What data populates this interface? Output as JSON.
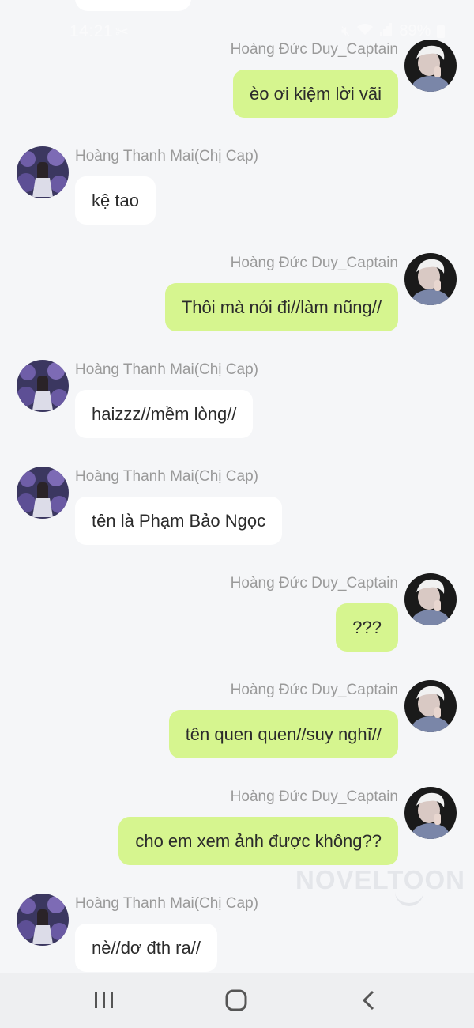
{
  "status_bar": {
    "time": "14:21",
    "app_icon": "capcut-icon",
    "battery": "89%",
    "icons": [
      "mute-icon",
      "wifi-icon",
      "signal-icon",
      "battery-icon"
    ]
  },
  "messages": [
    {
      "side": "sent",
      "sender": "Hoàng Đức Duy_Captain",
      "text": "èo ơi kiệm lời vãi"
    },
    {
      "side": "received",
      "sender": "Hoàng Thanh Mai(Chị Cap)",
      "text": "kệ tao"
    },
    {
      "side": "sent",
      "sender": "Hoàng Đức Duy_Captain",
      "text": "Thôi mà nói đi//làm nũng//"
    },
    {
      "side": "received",
      "sender": "Hoàng Thanh Mai(Chị Cap)",
      "text": "haizzz//mềm lòng//"
    },
    {
      "side": "received",
      "sender": "Hoàng Thanh Mai(Chị Cap)",
      "text": "tên là Phạm Bảo Ngọc"
    },
    {
      "side": "sent",
      "sender": "Hoàng Đức Duy_Captain",
      "text": "???"
    },
    {
      "side": "sent",
      "sender": "Hoàng Đức Duy_Captain",
      "text": "tên quen quen//suy nghĩ//"
    },
    {
      "side": "sent",
      "sender": "Hoàng Đức Duy_Captain",
      "text": "cho em xem ảnh được không??"
    },
    {
      "side": "received",
      "sender": "Hoàng Thanh Mai(Chị Cap)",
      "text": "nè//dơ đth ra//"
    }
  ],
  "watermark": "NOVELTOON",
  "nav": {
    "recent": "recent-apps-icon",
    "home": "home-icon",
    "back": "back-icon"
  },
  "colors": {
    "background": "#f5f6f8",
    "sent_bubble": "#d6f58f",
    "received_bubble": "#ffffff",
    "sender_name": "#9a9a9a",
    "message_text": "#2b2b2b"
  }
}
